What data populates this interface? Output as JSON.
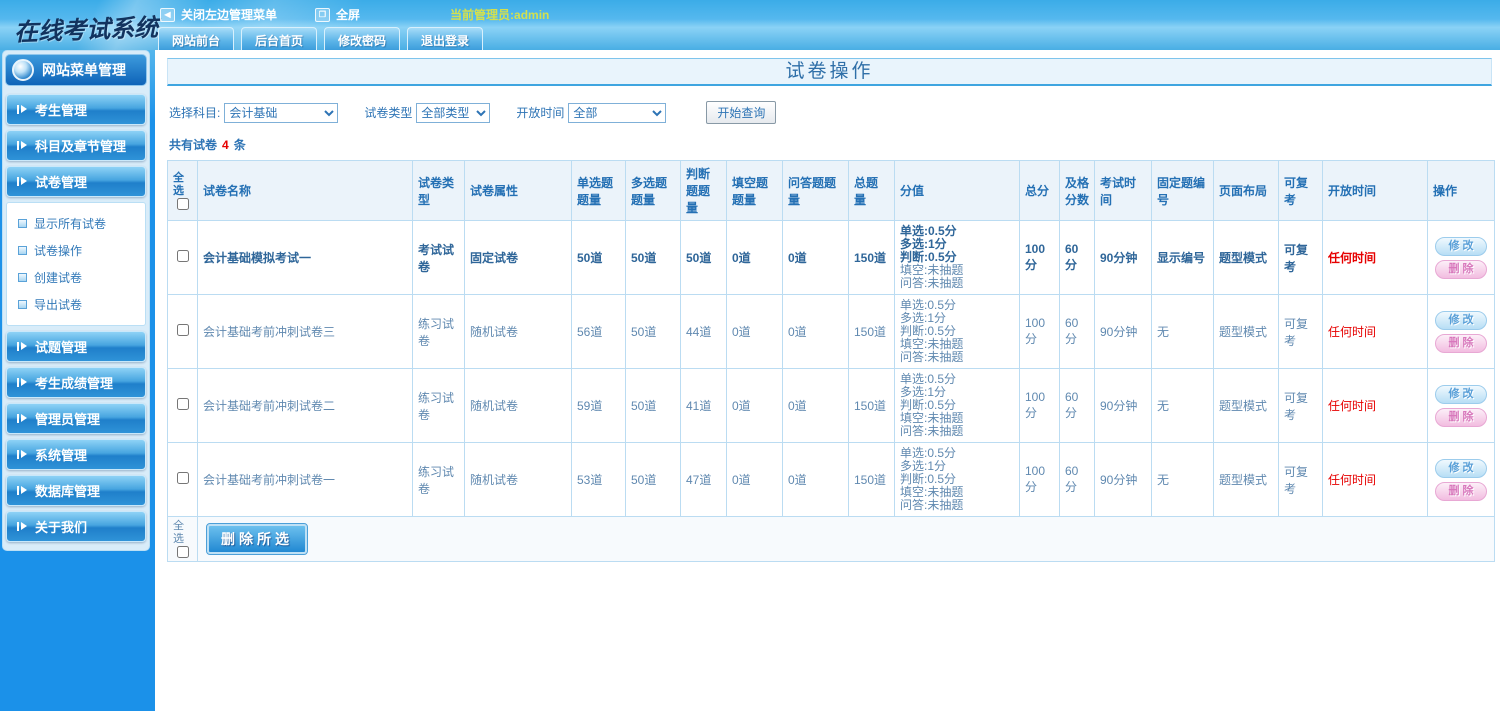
{
  "colors": {
    "topbar_blue": "#3BACE8",
    "sidebar_blue": "#1B91E9",
    "accent_blue": "#2470B4",
    "highlight_red": "#E60000",
    "admin_text_yellow": "#D3E04E"
  },
  "topbar": {
    "logo": "在线考试系统",
    "collapse_menu": "关闭左边管理菜单",
    "fullscreen": "全屏",
    "admin_label": "当前管理员:admin",
    "tabs": [
      "网站前台",
      "后台首页",
      "修改密码",
      "退出登录"
    ]
  },
  "sidebar": {
    "header": "网站菜单管理",
    "menus_top": [
      "考生管理",
      "科目及章节管理",
      "试卷管理"
    ],
    "submenu": [
      "显示所有试卷",
      "试卷操作",
      "创建试卷",
      "导出试卷"
    ],
    "menus_bottom": [
      "试题管理",
      "考生成绩管理",
      "管理员管理",
      "系统管理",
      "数据库管理",
      "关于我们"
    ]
  },
  "main": {
    "title": "试卷操作",
    "filters": {
      "subject_label": "选择科目:",
      "subject_value": "会计基础",
      "type_label": "试卷类型",
      "type_value": "全部类型",
      "open_label": "开放时间",
      "open_value": "全部",
      "search_button": "开始查询"
    },
    "summary": {
      "prefix": "共有试卷",
      "count": "4",
      "suffix": "条"
    },
    "table": {
      "select_all_label": "全选",
      "headers": [
        "试卷名称",
        "试卷类型",
        "试卷属性",
        "单选题题量",
        "多选题题量",
        "判断题题量",
        "填空题题量",
        "问答题题量",
        "总题量",
        "分值",
        "总分",
        "及格分数",
        "考试时间",
        "固定题编号",
        "页面布局",
        "可复考",
        "开放时间",
        "操作"
      ],
      "ops": {
        "edit": "修改",
        "delete": "删除"
      },
      "rows": [
        {
          "name": "会计基础模拟考试一",
          "type": "考试试卷",
          "attr": "固定试卷",
          "single": "50道",
          "multi": "50道",
          "judge": "50道",
          "blank": "0道",
          "qa": "0道",
          "total": "150道",
          "scores": [
            "单选:0.5分",
            "多选:1分",
            "判断:0.5分",
            "填空:未抽题",
            "问答:未抽题"
          ],
          "score_bold_count": 3,
          "total_score": "100分",
          "pass_score": "60分",
          "exam_time": "90分钟",
          "fixed_no": "显示编号",
          "layout": "题型模式",
          "retake": "可复考",
          "open_time": "任何时间",
          "bold": true
        },
        {
          "name": "会计基础考前冲刺试卷三",
          "type": "练习试卷",
          "attr": "随机试卷",
          "single": "56道",
          "multi": "50道",
          "judge": "44道",
          "blank": "0道",
          "qa": "0道",
          "total": "150道",
          "scores": [
            "单选:0.5分",
            "多选:1分",
            "判断:0.5分",
            "填空:未抽题",
            "问答:未抽题"
          ],
          "score_bold_count": 0,
          "total_score": "100分",
          "pass_score": "60分",
          "exam_time": "90分钟",
          "fixed_no": "无",
          "layout": "题型模式",
          "retake": "可复考",
          "open_time": "任何时间",
          "bold": false
        },
        {
          "name": "会计基础考前冲刺试卷二",
          "type": "练习试卷",
          "attr": "随机试卷",
          "single": "59道",
          "multi": "50道",
          "judge": "41道",
          "blank": "0道",
          "qa": "0道",
          "total": "150道",
          "scores": [
            "单选:0.5分",
            "多选:1分",
            "判断:0.5分",
            "填空:未抽题",
            "问答:未抽题"
          ],
          "score_bold_count": 0,
          "total_score": "100分",
          "pass_score": "60分",
          "exam_time": "90分钟",
          "fixed_no": "无",
          "layout": "题型模式",
          "retake": "可复考",
          "open_time": "任何时间",
          "bold": false
        },
        {
          "name": "会计基础考前冲刺试卷一",
          "type": "练习试卷",
          "attr": "随机试卷",
          "single": "53道",
          "multi": "50道",
          "judge": "47道",
          "blank": "0道",
          "qa": "0道",
          "total": "150道",
          "scores": [
            "单选:0.5分",
            "多选:1分",
            "判断:0.5分",
            "填空:未抽题",
            "问答:未抽题"
          ],
          "score_bold_count": 0,
          "total_score": "100分",
          "pass_score": "60分",
          "exam_time": "90分钟",
          "fixed_no": "无",
          "layout": "题型模式",
          "retake": "可复考",
          "open_time": "任何时间",
          "bold": false
        }
      ],
      "footer": {
        "select_all_label": "全选",
        "delete_button": "删除所选"
      }
    }
  }
}
